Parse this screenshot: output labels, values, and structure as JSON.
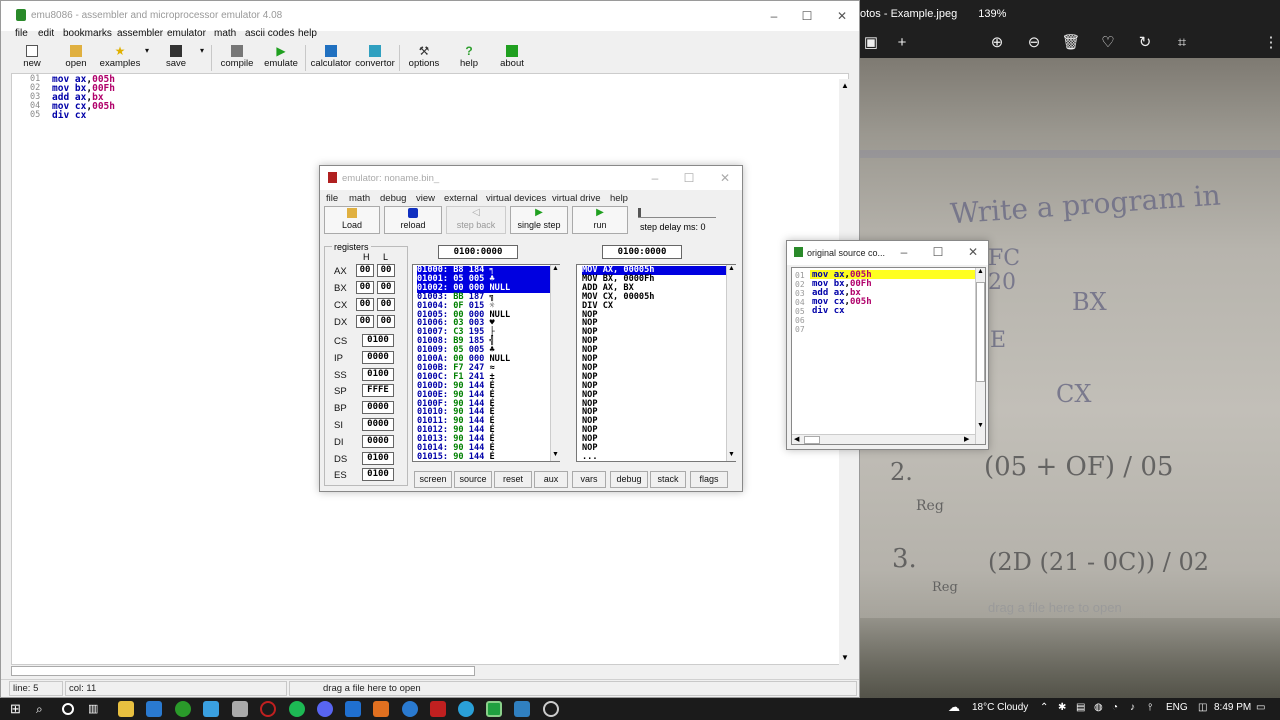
{
  "photos": {
    "title": "otos - Example.jpeg",
    "zoom": "139%",
    "toolbar": [
      "image-icon",
      "plus-icon",
      "zoom-in-icon",
      "zoom-out-icon",
      "trash-icon",
      "heart-icon",
      "rotate-icon",
      "crop-icon",
      "more-icon"
    ],
    "handwriting": [
      "Write a program in",
      "FC",
      "20",
      "BX",
      "E",
      "CX",
      "2.",
      "(05 + OF) / 05",
      "Reg",
      "3.",
      "(2D (21 - 0C)) / 02",
      "Reg"
    ],
    "drop_hint": "drag a file here to open"
  },
  "ide": {
    "title": "emu8086 - assembler and microprocessor emulator 4.08",
    "menu": [
      "file",
      "edit",
      "bookmarks",
      "assembler",
      "emulator",
      "math",
      "ascii codes",
      "help"
    ],
    "toolbar": {
      "new": "new",
      "open": "open",
      "examples": "examples",
      "save": "save",
      "compile": "compile",
      "emulate": "emulate",
      "calculator": "calculator",
      "convertor": "convertor",
      "options": "options",
      "help": "help",
      "about": "about"
    },
    "code": [
      {
        "n": "01",
        "op": "mov",
        "a": "ax",
        "b": "005h"
      },
      {
        "n": "02",
        "op": "mov",
        "a": "bx",
        "b": "00Fh"
      },
      {
        "n": "03",
        "op": "add",
        "a": "ax",
        "b": "bx"
      },
      {
        "n": "04",
        "op": "mov",
        "a": "cx",
        "b": "005h"
      },
      {
        "n": "05",
        "op": "div",
        "a": "cx",
        "b": ""
      }
    ],
    "status": {
      "line": "line: 5",
      "col": "col: 11",
      "hint": "drag a file here to open"
    }
  },
  "emulator": {
    "title": "emulator: noname.bin_",
    "menu": [
      "file",
      "math",
      "debug",
      "view",
      "external",
      "virtual devices",
      "virtual drive",
      "help"
    ],
    "buttons": {
      "load": "Load",
      "reload": "reload",
      "step_back": "step back",
      "single_step": "single step",
      "run": "run"
    },
    "step_delay": "step delay ms: 0",
    "registers_label": "registers",
    "h_label": "H",
    "l_label": "L",
    "gp": [
      {
        "name": "AX",
        "h": "00",
        "l": "00"
      },
      {
        "name": "BX",
        "h": "00",
        "l": "00"
      },
      {
        "name": "CX",
        "h": "00",
        "l": "00"
      },
      {
        "name": "DX",
        "h": "00",
        "l": "00"
      }
    ],
    "seg": [
      {
        "name": "CS",
        "v": "0100"
      },
      {
        "name": "IP",
        "v": "0000"
      },
      {
        "name": "SS",
        "v": "0100"
      },
      {
        "name": "SP",
        "v": "FFFE"
      },
      {
        "name": "BP",
        "v": "0000"
      },
      {
        "name": "SI",
        "v": "0000"
      },
      {
        "name": "DI",
        "v": "0000"
      },
      {
        "name": "DS",
        "v": "0100"
      },
      {
        "name": "ES",
        "v": "0100"
      }
    ],
    "mem_addr": "0100:0000",
    "dis_addr": "0100:0000",
    "memory": [
      [
        "01000:",
        "B8",
        "184",
        "╕"
      ],
      [
        "01001:",
        "05",
        "005",
        "♣"
      ],
      [
        "01002:",
        "00",
        "000",
        "NULL"
      ],
      [
        "01003:",
        "BB",
        "187",
        "╗"
      ],
      [
        "01004:",
        "0F",
        "015",
        "☼"
      ],
      [
        "01005:",
        "00",
        "000",
        "NULL"
      ],
      [
        "01006:",
        "03",
        "003",
        "♥"
      ],
      [
        "01007:",
        "C3",
        "195",
        "├"
      ],
      [
        "01008:",
        "B9",
        "185",
        "╣"
      ],
      [
        "01009:",
        "05",
        "005",
        "♣"
      ],
      [
        "0100A:",
        "00",
        "000",
        "NULL"
      ],
      [
        "0100B:",
        "F7",
        "247",
        "≈"
      ],
      [
        "0100C:",
        "F1",
        "241",
        "±"
      ],
      [
        "0100D:",
        "90",
        "144",
        "É"
      ],
      [
        "0100E:",
        "90",
        "144",
        "É"
      ],
      [
        "0100F:",
        "90",
        "144",
        "É"
      ],
      [
        "01010:",
        "90",
        "144",
        "É"
      ],
      [
        "01011:",
        "90",
        "144",
        "É"
      ],
      [
        "01012:",
        "90",
        "144",
        "É"
      ],
      [
        "01013:",
        "90",
        "144",
        "É"
      ],
      [
        "01014:",
        "90",
        "144",
        "É"
      ],
      [
        "01015:",
        "90",
        "144",
        "É"
      ]
    ],
    "disasm": [
      "MOV AX, 00005h",
      "MOV BX, 0000Fh",
      "ADD AX, BX",
      "MOV CX, 00005h",
      "DIV CX",
      "NOP",
      "NOP",
      "NOP",
      "NOP",
      "NOP",
      "NOP",
      "NOP",
      "NOP",
      "NOP",
      "NOP",
      "NOP",
      "NOP",
      "NOP",
      "NOP",
      "NOP",
      "NOP",
      "..."
    ],
    "bottom": [
      "screen",
      "source",
      "reset",
      "aux",
      "vars",
      "debug",
      "stack",
      "flags"
    ]
  },
  "source": {
    "title": "original source co...",
    "lines": [
      {
        "n": "01",
        "op": "mov",
        "a": "ax",
        "b": "005h"
      },
      {
        "n": "02",
        "op": "mov",
        "a": "bx",
        "b": "00Fh"
      },
      {
        "n": "03",
        "op": "add",
        "a": "ax",
        "b": "bx"
      },
      {
        "n": "04",
        "op": "mov",
        "a": "cx",
        "b": "005h"
      },
      {
        "n": "05",
        "op": "div",
        "a": "cx",
        "b": ""
      },
      {
        "n": "06",
        "op": "",
        "a": "",
        "b": ""
      },
      {
        "n": "07",
        "op": "",
        "a": "",
        "b": ""
      }
    ]
  },
  "taskbar": {
    "weather": "18°C Cloudy",
    "lang": "ENG",
    "time": "8:49 PM"
  }
}
